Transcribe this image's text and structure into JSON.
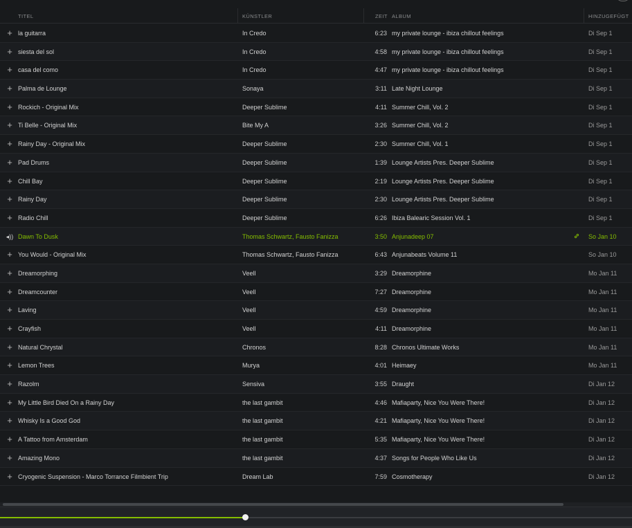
{
  "header": {
    "col_title": "TITEL",
    "col_artist": "KÜNSTLER",
    "col_time": "ZEIT",
    "col_album": "ALBUM",
    "col_added": "HINZUGEFÜGT"
  },
  "icons": {
    "add": "+",
    "speaker": "◂))",
    "link": "🔗"
  },
  "colors": {
    "accent": "#84bd00",
    "background": "#181a1c"
  },
  "tracks": [
    {
      "title": "la guitarra",
      "artist": "In Credo",
      "time": "6:23",
      "album": "my private lounge - ibiza chillout feelings",
      "added": "Di Sep 1"
    },
    {
      "title": "siesta del sol",
      "artist": "In Credo",
      "time": "4:58",
      "album": "my private lounge - ibiza chillout feelings",
      "added": "Di Sep 1"
    },
    {
      "title": "casa del como",
      "artist": "In Credo",
      "time": "4:47",
      "album": "my private lounge - ibiza chillout feelings",
      "added": "Di Sep 1"
    },
    {
      "title": "Palma de Lounge",
      "artist": "Sonaya",
      "time": "3:11",
      "album": "Late Night Lounge",
      "added": "Di Sep 1"
    },
    {
      "title": "Rockich - Original Mix",
      "artist": "Deeper Sublime",
      "time": "4:11",
      "album": "Summer Chill, Vol. 2",
      "added": "Di Sep 1"
    },
    {
      "title": "Ti Belle - Original Mix",
      "artist": "Bite My A",
      "time": "3:26",
      "album": "Summer Chill, Vol. 2",
      "added": "Di Sep 1"
    },
    {
      "title": "Rainy Day - Original Mix",
      "artist": "Deeper Sublime",
      "time": "2:30",
      "album": "Summer Chill, Vol. 1",
      "added": "Di Sep 1"
    },
    {
      "title": "Pad Drums",
      "artist": "Deeper Sublime",
      "time": "1:39",
      "album": "Lounge Artists Pres. Deeper Sublime",
      "added": "Di Sep 1"
    },
    {
      "title": "Chill Bay",
      "artist": "Deeper Sublime",
      "time": "2:19",
      "album": "Lounge Artists Pres. Deeper Sublime",
      "added": "Di Sep 1"
    },
    {
      "title": "Rainy Day",
      "artist": "Deeper Sublime",
      "time": "2:30",
      "album": "Lounge Artists Pres. Deeper Sublime",
      "added": "Di Sep 1"
    },
    {
      "title": "Radio Chill",
      "artist": "Deeper Sublime",
      "time": "6:26",
      "album": "Ibiza Balearic Session Vol. 1",
      "added": "Di Sep 1"
    },
    {
      "title": "Dawn To Dusk",
      "artist": "Thomas Schwartz, Fausto Fanizza",
      "time": "3:50",
      "album": "Anjunadeep 07",
      "added": "So Jan 10",
      "playing": true
    },
    {
      "title": "You Would - Original Mix",
      "artist": "Thomas Schwartz, Fausto Fanizza",
      "time": "6:43",
      "album": "Anjunabeats Volume 11",
      "added": "So Jan 10"
    },
    {
      "title": "Dreamorphing",
      "artist": "Veell",
      "time": "3:29",
      "album": "Dreamorphine",
      "added": "Mo Jan 11"
    },
    {
      "title": "Dreamcounter",
      "artist": "Veell",
      "time": "7:27",
      "album": "Dreamorphine",
      "added": "Mo Jan 11"
    },
    {
      "title": "Laving",
      "artist": "Veell",
      "time": "4:59",
      "album": "Dreamorphine",
      "added": "Mo Jan 11"
    },
    {
      "title": "Crayfish",
      "artist": "Veell",
      "time": "4:11",
      "album": "Dreamorphine",
      "added": "Mo Jan 11"
    },
    {
      "title": "Natural Chrystal",
      "artist": "Chronos",
      "time": "8:28",
      "album": "Chronos Ultimate Works",
      "added": "Mo Jan 11"
    },
    {
      "title": "Lemon Trees",
      "artist": "Murya",
      "time": "4:01",
      "album": "Heimaey",
      "added": "Mo Jan 11"
    },
    {
      "title": "Razolm",
      "artist": "Sensiva",
      "time": "3:55",
      "album": "Draught",
      "added": "Di Jan 12"
    },
    {
      "title": "My Little Bird Died On a Rainy Day",
      "artist": "the last gambit",
      "time": "4:46",
      "album": "Mafiaparty, Nice You Were There!",
      "added": "Di Jan 12"
    },
    {
      "title": "Whisky Is a Good God",
      "artist": "the last gambit",
      "time": "4:21",
      "album": "Mafiaparty, Nice You Were There!",
      "added": "Di Jan 12"
    },
    {
      "title": "A Tattoo from Amsterdam",
      "artist": "the last gambit",
      "time": "5:35",
      "album": "Mafiaparty, Nice You Were There!",
      "added": "Di Jan 12"
    },
    {
      "title": "Amazing Mono",
      "artist": "the last gambit",
      "time": "4:37",
      "album": "Songs for People Who Like Us",
      "added": "Di Jan 12"
    },
    {
      "title": "Cryogenic Suspension - Marco Torrance Filmbient Trip",
      "artist": "Dream Lab",
      "time": "7:59",
      "album": "Cosmotherapy",
      "added": "Di Jan 12"
    }
  ],
  "player": {
    "progress": 0.388
  }
}
